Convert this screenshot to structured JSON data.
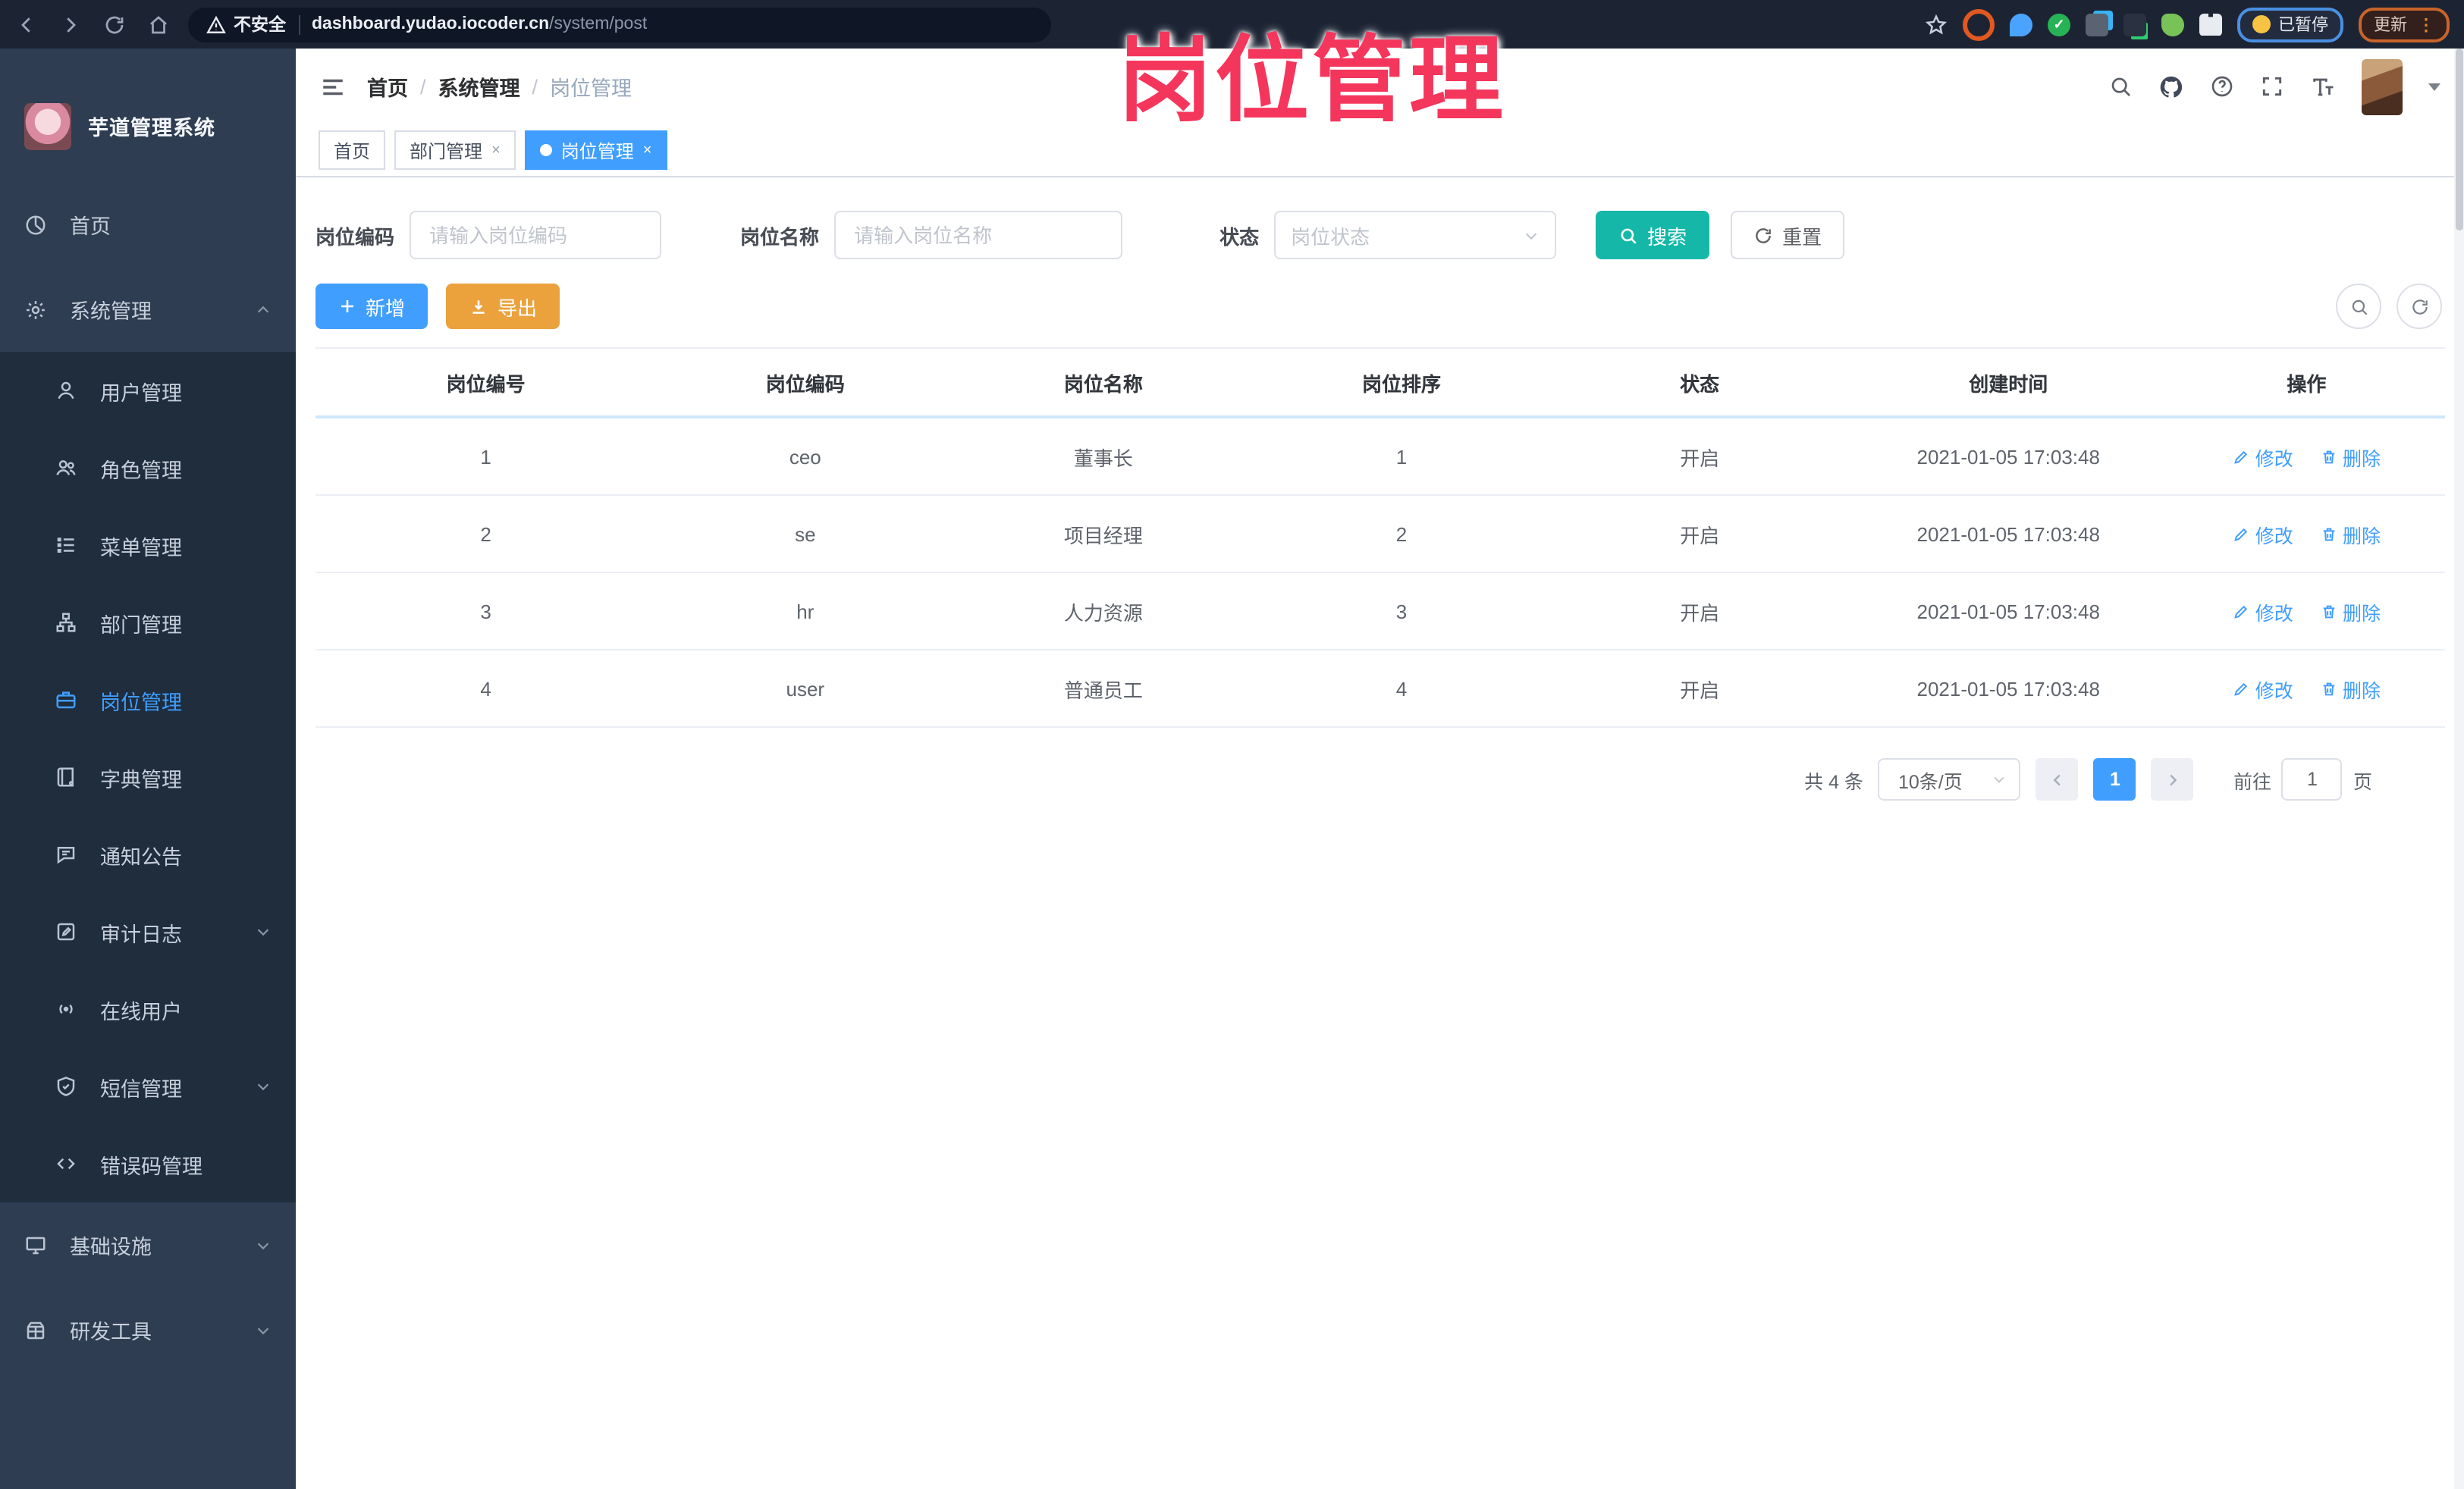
{
  "overlay": {
    "title": "岗位管理",
    "color": "#f5365c"
  },
  "browser": {
    "security_label": "不安全",
    "url_host": "dashboard.yudao.iocoder.cn",
    "url_path": "/system/post",
    "paused_badge": "已暂停",
    "update_button": "更新"
  },
  "sidebar": {
    "app_title": "芋道管理系统",
    "home": "首页",
    "system": "系统管理",
    "sub": [
      "用户管理",
      "角色管理",
      "菜单管理",
      "部门管理",
      "岗位管理",
      "字典管理",
      "通知公告",
      "审计日志",
      "在线用户",
      "短信管理",
      "错误码管理"
    ],
    "infra": "基础设施",
    "devtools": "研发工具"
  },
  "breadcrumb": {
    "items": [
      "首页",
      "系统管理",
      "岗位管理"
    ],
    "separator": "/"
  },
  "tabs": [
    {
      "label": "首页"
    },
    {
      "label": "部门管理",
      "close": "×"
    },
    {
      "label": "岗位管理",
      "close": "×"
    }
  ],
  "filter": {
    "code_label": "岗位编码",
    "code_placeholder": "请输入岗位编码",
    "name_label": "岗位名称",
    "name_placeholder": "请输入岗位名称",
    "status_label": "状态",
    "status_placeholder": "岗位状态",
    "search": "搜索",
    "reset": "重置"
  },
  "toolbar": {
    "add": "新增",
    "export": "导出"
  },
  "table": {
    "columns": [
      "岗位编号",
      "岗位编码",
      "岗位名称",
      "岗位排序",
      "状态",
      "创建时间",
      "操作"
    ],
    "edit": "修改",
    "delete": "删除",
    "rows": [
      {
        "id": "1",
        "code": "ceo",
        "name": "董事长",
        "sort": "1",
        "status": "开启",
        "created": "2021-01-05 17:03:48"
      },
      {
        "id": "2",
        "code": "se",
        "name": "项目经理",
        "sort": "2",
        "status": "开启",
        "created": "2021-01-05 17:03:48"
      },
      {
        "id": "3",
        "code": "hr",
        "name": "人力资源",
        "sort": "3",
        "status": "开启",
        "created": "2021-01-05 17:03:48"
      },
      {
        "id": "4",
        "code": "user",
        "name": "普通员工",
        "sort": "4",
        "status": "开启",
        "created": "2021-01-05 17:03:48"
      }
    ]
  },
  "pagination": {
    "total": "共 4 条",
    "page_size": "10条/页",
    "page": "1",
    "goto_prefix": "前往",
    "goto_value": "1",
    "goto_suffix": "页"
  },
  "colors": {
    "accent": "#409EFF",
    "search_button": "#15b8a8",
    "export_button": "#EBA23C",
    "sidebar_bg": "#2f3d52",
    "submenu_bg": "#1f2d3d"
  }
}
